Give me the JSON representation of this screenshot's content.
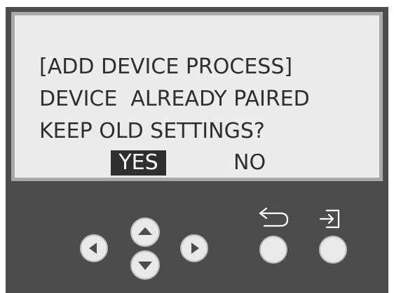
{
  "screen": {
    "line1": "[ADD DEVICE PROCESS]",
    "line2": "DEVICE  ALREADY PAIRED",
    "line3": "KEEP OLD SETTINGS?",
    "options": [
      {
        "label": "YES",
        "selected": true
      },
      {
        "label": "NO",
        "selected": false
      }
    ]
  },
  "controls": {
    "buttons": [
      {
        "name": "left-button",
        "icon": "triangle-left-icon"
      },
      {
        "name": "up-button",
        "icon": "triangle-up-icon"
      },
      {
        "name": "down-button",
        "icon": "triangle-down-icon"
      },
      {
        "name": "right-button",
        "icon": "triangle-right-icon"
      },
      {
        "name": "back-button",
        "icon": "return-arrow-icon"
      },
      {
        "name": "enter-button",
        "icon": "enter-icon"
      }
    ]
  },
  "colors": {
    "panel": "#4c4c4c",
    "screen": "#ececec",
    "screen_border": "#a9a9a9",
    "text": "#2f2f2f",
    "highlight_bg": "#2f2f2f",
    "highlight_text": "#ffffff",
    "button_face": "#e9e9e9",
    "glyph": "#4c4c4c"
  }
}
